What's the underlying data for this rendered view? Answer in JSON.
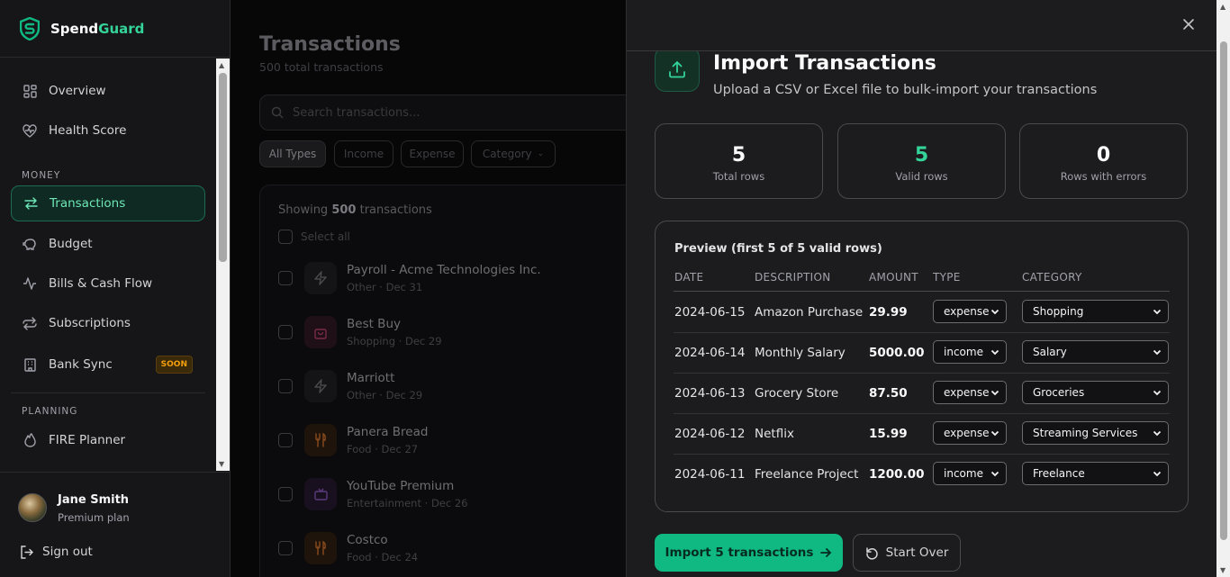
{
  "app": {
    "brand_first": "Spend",
    "brand_second": "Guard",
    "accent": "#34d399"
  },
  "sidebar": {
    "items_top": [
      {
        "label": "Overview",
        "icon": "grid-icon"
      },
      {
        "label": "Health Score",
        "icon": "heart-pulse-icon"
      }
    ],
    "money_label": "MONEY",
    "items_money": [
      {
        "label": "Transactions",
        "icon": "arrows-swap-icon",
        "active": true
      },
      {
        "label": "Budget",
        "icon": "piggy-bank-icon"
      },
      {
        "label": "Bills & Cash Flow",
        "icon": "activity-icon"
      },
      {
        "label": "Subscriptions",
        "icon": "repeat-icon"
      },
      {
        "label": "Bank Sync",
        "icon": "bank-icon",
        "badge": "SOON"
      }
    ],
    "planning_label": "PLANNING",
    "items_planning": [
      {
        "label": "FIRE Planner",
        "icon": "flame-icon"
      }
    ],
    "user": {
      "name": "Jane Smith",
      "plan": "Premium plan"
    },
    "signout": "Sign out"
  },
  "main": {
    "title": "Transactions",
    "subtitle": "500 total transactions",
    "search_placeholder": "Search transactions...",
    "filters": [
      "All Types",
      "Income",
      "Expense",
      "Category"
    ],
    "showing_prefix": "Showing",
    "showing_count": "500",
    "showing_suffix": "transactions",
    "select_all": "Select all",
    "transactions": [
      {
        "name": "Payroll - Acme Technologies Inc.",
        "meta": "Other · Dec 31",
        "icon": "bolt-icon"
      },
      {
        "name": "Best Buy",
        "meta": "Shopping · Dec 29",
        "icon": "shopping-bag-icon"
      },
      {
        "name": "Marriott",
        "meta": "Other · Dec 29",
        "icon": "bolt-icon"
      },
      {
        "name": "Panera Bread",
        "meta": "Food · Dec 27",
        "icon": "utensils-icon"
      },
      {
        "name": "YouTube Premium",
        "meta": "Entertainment · Dec 26",
        "icon": "tv-icon"
      },
      {
        "name": "Costco",
        "meta": "Food · Dec 24",
        "icon": "utensils-icon"
      }
    ]
  },
  "import": {
    "title": "Import Transactions",
    "subtitle": "Upload a CSV or Excel file to bulk-import your transactions",
    "stats": [
      {
        "value": "5",
        "label": "Total rows"
      },
      {
        "value": "5",
        "label": "Valid rows"
      },
      {
        "value": "0",
        "label": "Rows with errors"
      }
    ],
    "preview_title": "Preview (first 5 of 5 valid rows)",
    "columns": [
      "DATE",
      "DESCRIPTION",
      "AMOUNT",
      "TYPE",
      "CATEGORY"
    ],
    "rows": [
      {
        "date": "2024-06-15",
        "description": "Amazon Purchase",
        "amount": "29.99",
        "type": "expense",
        "category": "Shopping"
      },
      {
        "date": "2024-06-14",
        "description": "Monthly Salary",
        "amount": "5000.00",
        "type": "income",
        "category": "Salary"
      },
      {
        "date": "2024-06-13",
        "description": "Grocery Store",
        "amount": "87.50",
        "type": "expense",
        "category": "Groceries"
      },
      {
        "date": "2024-06-12",
        "description": "Netflix",
        "amount": "15.99",
        "type": "expense",
        "category": "Streaming Services"
      },
      {
        "date": "2024-06-11",
        "description": "Freelance Project",
        "amount": "1200.00",
        "type": "income",
        "category": "Freelance"
      }
    ],
    "import_button": "Import 5 transactions",
    "start_over_button": "Start Over"
  }
}
